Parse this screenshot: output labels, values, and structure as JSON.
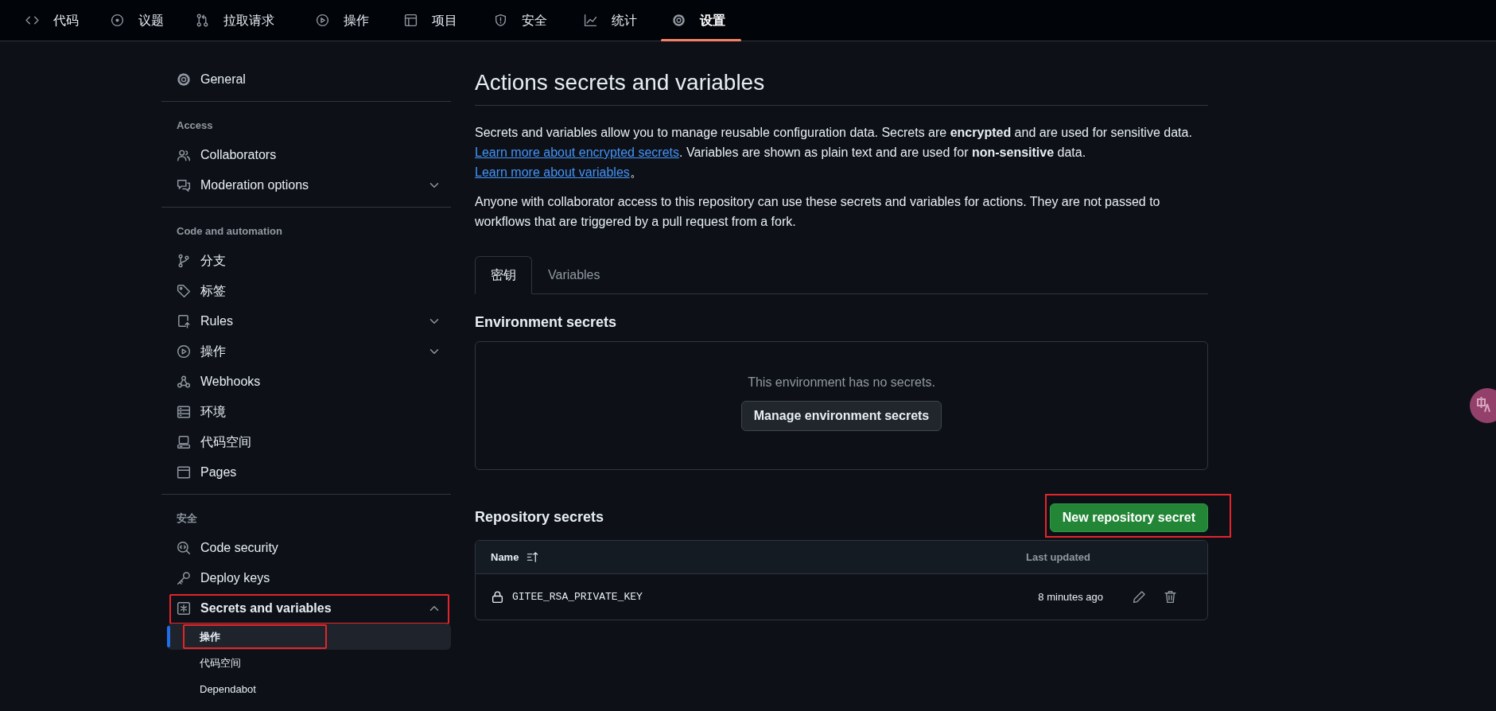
{
  "top_nav": [
    {
      "label": "代码",
      "selected": false
    },
    {
      "label": "议题",
      "selected": false
    },
    {
      "label": "拉取请求",
      "selected": false
    },
    {
      "label": "操作",
      "selected": false
    },
    {
      "label": "项目",
      "selected": false
    },
    {
      "label": "安全",
      "selected": false
    },
    {
      "label": "统计",
      "selected": false
    },
    {
      "label": "设置",
      "selected": true
    }
  ],
  "sidebar": {
    "groups": [
      {
        "items": [
          {
            "label": "General",
            "selected": false,
            "annotated": false
          }
        ]
      },
      {
        "heading": "Access",
        "items": [
          {
            "label": "Collaborators",
            "selected": false,
            "annotated": false
          },
          {
            "label": "Moderation options",
            "selected": false,
            "annotated": false,
            "expanded": false
          }
        ]
      },
      {
        "heading": "Code and automation",
        "items": [
          {
            "label": "分支",
            "selected": false,
            "annotated": false
          },
          {
            "label": "标签",
            "selected": false,
            "annotated": false
          },
          {
            "label": "Rules",
            "selected": false,
            "annotated": false,
            "expanded": false
          },
          {
            "label": "操作",
            "selected": false,
            "annotated": false,
            "expanded": false
          },
          {
            "label": "Webhooks",
            "selected": false,
            "annotated": false
          },
          {
            "label": "环境",
            "selected": false,
            "annotated": false
          },
          {
            "label": "代码空间",
            "selected": false,
            "annotated": false
          },
          {
            "label": "Pages",
            "selected": false,
            "annotated": false
          }
        ]
      },
      {
        "heading": "安全",
        "items": [
          {
            "label": "Code security",
            "selected": false,
            "annotated": false
          },
          {
            "label": "Deploy keys",
            "selected": false,
            "annotated": false
          },
          {
            "label": "Secrets and variables",
            "selected": false,
            "annotated": true,
            "expanded": true,
            "children": [
              {
                "label": "操作",
                "selected": true,
                "annotated": true
              },
              {
                "label": "代码空间",
                "selected": false,
                "annotated": false
              },
              {
                "label": "Dependabot",
                "selected": false,
                "annotated": false
              }
            ]
          }
        ]
      }
    ]
  },
  "page": {
    "title": "Actions secrets and variables",
    "intro": [
      {
        "kind": "text",
        "text": "Secrets and variables allow you to manage reusable configuration data. Secrets are **encrypted** and are used for sensitive data. "
      },
      {
        "kind": "link",
        "text": "Learn more about encrypted secrets"
      },
      {
        "kind": "text",
        "text": ". Variables are shown as plain text and are used for **non-sensitive** data. "
      },
      {
        "kind": "link",
        "text": "Learn more about variables"
      },
      {
        "kind": "text",
        "text": "。"
      }
    ],
    "note": "Anyone with collaborator access to this repository can use these secrets and variables for actions. They are not passed to workflows that are triggered by a pull request from a fork.",
    "tabs": [
      {
        "label": "密钥",
        "selected": true
      },
      {
        "label": "Variables",
        "selected": false
      }
    ],
    "environment": {
      "heading": "Environment secrets",
      "empty_text": "This environment has no secrets.",
      "button": "Manage environment secrets"
    },
    "repository": {
      "heading": "Repository secrets",
      "button": {
        "label": "New repository secret",
        "annotated": true
      },
      "table": {
        "columns": [
          "Name",
          "Last updated"
        ],
        "rows": [
          {
            "name": "GITEE_RSA_PRIVATE_KEY",
            "updated": "8 minutes ago"
          }
        ]
      }
    }
  }
}
